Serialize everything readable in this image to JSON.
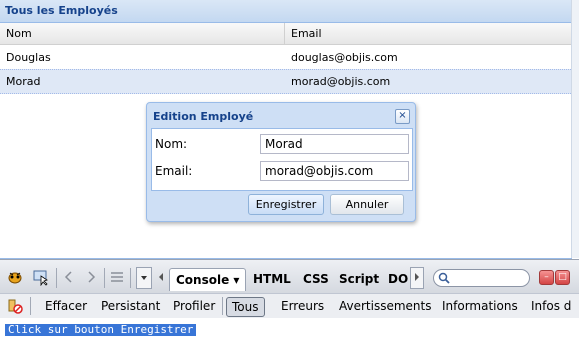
{
  "grid": {
    "title": "Tous les Employés",
    "columns": [
      "Nom",
      "Email"
    ],
    "rows": [
      {
        "nom": "Douglas",
        "email": "douglas@objis.com"
      },
      {
        "nom": "Morad",
        "email": "morad@objis.com"
      }
    ]
  },
  "dialog": {
    "title": "Edition Employé",
    "close_glyph": "×",
    "fields": [
      {
        "label": "Nom:",
        "value": "Morad"
      },
      {
        "label": "Email:",
        "value": "morad@objis.com"
      }
    ],
    "buttons": {
      "save": "Enregistrer",
      "cancel": "Annuler"
    }
  },
  "firebug": {
    "tabs": {
      "console": "Console ▾",
      "html": "HTML",
      "css": "CSS",
      "script": "Script",
      "dom": "DO"
    },
    "subtoolbar": [
      "Effacer",
      "Persistant",
      "Profiler",
      "Tous",
      "Erreurs",
      "Avertissements",
      "Informations",
      "Infos d"
    ],
    "console_output": "Click sur bouton Enregistrer",
    "icons": [
      "firebug-icon",
      "inspect-icon",
      "back-icon",
      "forward-icon",
      "list-icon",
      "dropdown-icon",
      "search-icon",
      "minimize-icon",
      "close-icon",
      "clear-console-icon"
    ]
  }
}
